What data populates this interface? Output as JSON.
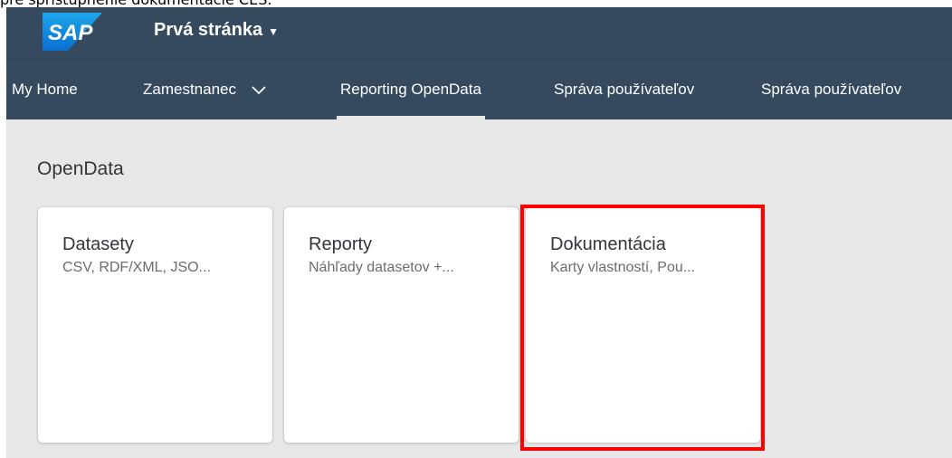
{
  "caption": "pre sprístupnenie dokumentácie CES.",
  "shell": {
    "logo_text": "SAP",
    "page_title": "Prvá stránka",
    "page_title_caret": "▼"
  },
  "nav": {
    "items": [
      {
        "label": "My Home"
      },
      {
        "label": "Zamestnanec"
      },
      {
        "label": "Reporting OpenData"
      },
      {
        "label": "Správa používateľov"
      },
      {
        "label": "Správa používateľov"
      }
    ]
  },
  "group": {
    "title": "OpenData"
  },
  "tiles": [
    {
      "title": "Datasety",
      "subtitle": "CSV, RDF/XML, JSO..."
    },
    {
      "title": "Reporty",
      "subtitle": "Náhľady datasetov +..."
    },
    {
      "title": "Dokumentácia",
      "subtitle": "Karty vlastností, Pou..."
    }
  ],
  "colors": {
    "shell_bg": "#354a5f",
    "page_bg": "#e7e7e7",
    "highlight": "#ff0000"
  },
  "icons": {
    "nav_dropdown": "chevron-down-icon",
    "title_dropdown": "caret-down-icon"
  }
}
